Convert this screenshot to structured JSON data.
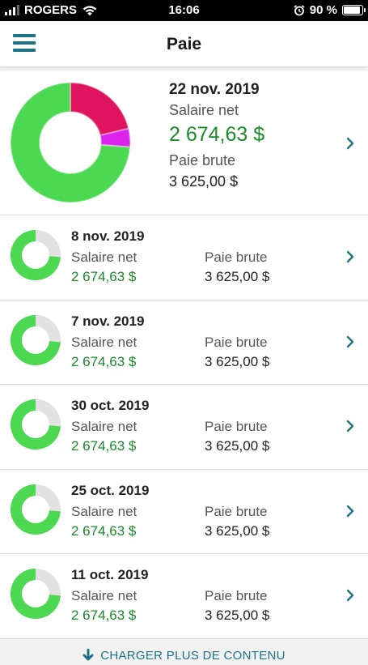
{
  "status_bar": {
    "carrier": "ROGERS",
    "time": "16:06",
    "battery": "90 %",
    "battery_level": 0.9
  },
  "header": {
    "title": "Paie"
  },
  "featured": {
    "date": "22 nov. 2019",
    "net_label": "Salaire net",
    "net_value": "2 674,63 $",
    "gross_label": "Paie brute",
    "gross_value": "3 625,00 $",
    "breakdown": [
      {
        "value": 2674.63,
        "color": "#4cd850"
      },
      {
        "value": 770.37,
        "color": "#e0145e"
      },
      {
        "value": 180.0,
        "color": "#dd22ee"
      }
    ]
  },
  "pay_items": [
    {
      "date": "8 nov. 2019",
      "net_label": "Salaire net",
      "net_value": "2 674,63 $",
      "gross_label": "Paie brute",
      "gross_value": "3 625,00 $",
      "net_fraction": 0.738
    },
    {
      "date": "7 nov. 2019",
      "net_label": "Salaire net",
      "net_value": "2 674,63 $",
      "gross_label": "Paie brute",
      "gross_value": "3 625,00 $",
      "net_fraction": 0.738
    },
    {
      "date": "30 oct. 2019",
      "net_label": "Salaire net",
      "net_value": "2 674,63 $",
      "gross_label": "Paie brute",
      "gross_value": "3 625,00 $",
      "net_fraction": 0.738
    },
    {
      "date": "25 oct. 2019",
      "net_label": "Salaire net",
      "net_value": "2 674,63 $",
      "gross_label": "Paie brute",
      "gross_value": "3 625,00 $",
      "net_fraction": 0.738
    },
    {
      "date": "11 oct. 2019",
      "net_label": "Salaire net",
      "net_value": "2 674,63 $",
      "gross_label": "Paie brute",
      "gross_value": "3 625,00 $",
      "net_fraction": 0.738
    }
  ],
  "load_more": {
    "label": "CHARGER PLUS DE CONTENU"
  },
  "colors": {
    "accent": "#1e7286",
    "net_green": "#1a8a2a",
    "donut_green": "#4cd850",
    "donut_gray": "#e2e2e2"
  },
  "icons": {
    "menu": "hamburger-menu-icon",
    "chevron": "chevron-right-icon",
    "load_more": "arrow-down-icon"
  }
}
